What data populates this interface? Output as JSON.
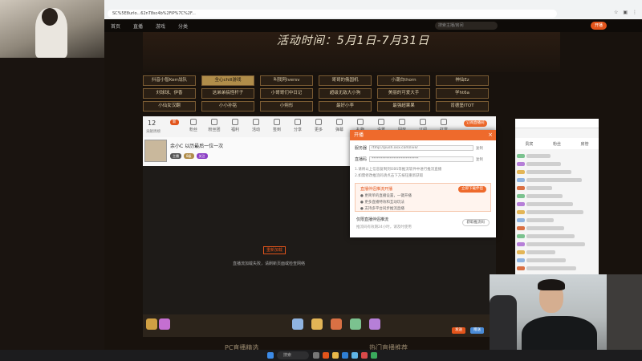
{
  "browser": {
    "url": "SC%5E8urlo...62nT8sc4b%2FiP%7C%2F...",
    "site_nav": [
      "首页",
      "直播",
      "游戏",
      "分类"
    ],
    "search_placeholder": "搜索主播/房间",
    "open_button": "开播"
  },
  "banner": {
    "title": "活动时间：5月1日-7月31日"
  },
  "teams": [
    "抖音小智Kerr战队",
    "全心chill游戏",
    "叫我阿iversv",
    "哥哥的俄国机",
    "小潮白thorn",
    "神仙Ez",
    "刘球球、伊香",
    "这弟弟搞怪杆子",
    "小哥哥们中日记",
    "超级无敌大小狗",
    "美丽的可爱大手",
    "学ht6a",
    "小仙女汉翻",
    "小小孙铭",
    "小朔彤",
    "最好小李",
    "最强超果果",
    "肯德堡ITOT"
  ],
  "toolbar": {
    "rank_number": "12",
    "rank_label": "贡献周榜",
    "new_badge": "新",
    "tools": [
      "粉丝",
      "粉丝团",
      "福利",
      "活动",
      "签到",
      "分享",
      "更多",
      "弹幕",
      "礼物",
      "设置",
      "回放",
      "订阅",
      "打赏"
    ],
    "right_button": "订阅直播间"
  },
  "streamer": {
    "name": "余小C  以历最后一位一次",
    "tags": [
      "主播",
      "8级",
      "关注"
    ]
  },
  "video": {
    "fail_button": "重新加载",
    "fail_text": "直播流加载失败，请刷新页面或检查网络"
  },
  "gifts": {
    "send_a": "发送",
    "send_b": "赠送"
  },
  "rpanel": {
    "tabs": [
      "贵宾",
      "粉丝",
      "房管"
    ],
    "input_placeholder": "来发个弹幕吧~"
  },
  "dialog": {
    "title": "开播",
    "server_label": "服务器",
    "server_value": "rtmp://push.xxx.com/live/",
    "key_label": "直播码",
    "key_value": "**************************",
    "copy": "复制",
    "note1": "1.请将以上信息复制到OBS等推流软件中进行推流直播",
    "note2": "2.如需修改推流码请点击下方按钮重新获取",
    "box_title": "直播伴侣推流开播",
    "box_button": "立即下载伴侣",
    "box_lines": [
      "● 更简单的直播设置，一键开播",
      "● 更多直播特效和互动玩法",
      "● 支持多平台同步推流直播"
    ],
    "bottom_title": "仅限直播伴侣推流",
    "bottom_line": "推流码有效期24小时，请及时使用",
    "bottom_button": "获取推流码"
  },
  "footer": {
    "left": "PC直播精选",
    "right": "热门直播推荐"
  },
  "taskbar": {
    "search": "搜索"
  }
}
